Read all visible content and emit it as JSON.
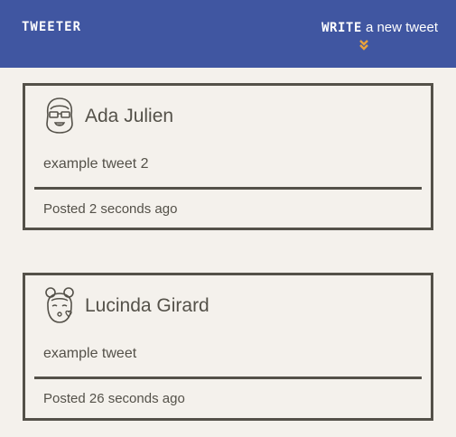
{
  "nav": {
    "brand": "TWEETER",
    "compose_strong": "WRITE",
    "compose_rest": " a new tweet",
    "compose_icon": "double-chevron-down-icon",
    "background": "#4056a1",
    "accent": "#e8a33d"
  },
  "tweets": [
    {
      "avatar_icon": "glasses-girl-avatar-icon",
      "name": "Ada Julien",
      "text": "example tweet 2",
      "posted": "Posted 2 seconds ago"
    },
    {
      "avatar_icon": "kissing-girl-avatar-icon",
      "name": "Lucinda Girard",
      "text": "example tweet",
      "posted": "Posted 26 seconds ago"
    }
  ]
}
